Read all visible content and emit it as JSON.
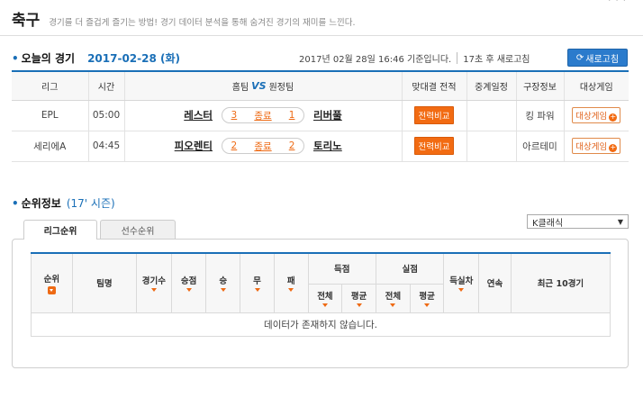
{
  "header": {
    "title": "축구",
    "description": "경기를 더 즐겁게 즐기는 방법! 경기 데이터 분석을 통해 숨겨진 경기의 재미를 느낀다."
  },
  "today": {
    "section_title": "오늘의 경기",
    "date": "2017-02-28 (화)",
    "updated_text": "2017년 02월 28일 16:46 기준입니다.",
    "countdown_text": "17초 후 새로고침",
    "refresh_button": "새로고침",
    "columns": {
      "league": "리그",
      "time": "시간",
      "home": "홈팀",
      "vs": "VS",
      "away": "원정팀",
      "h2h": "맞대결 전적",
      "broadcast": "중계일정",
      "stadium": "구장정보",
      "target": "대상게임"
    },
    "matches": [
      {
        "league": "EPL",
        "time": "05:00",
        "home": "레스터",
        "home_score": "3",
        "status": "종료",
        "away_score": "1",
        "away": "리버풀",
        "h2h_button": "전력비교",
        "broadcast": "",
        "stadium": "킹 파워",
        "target_button": "대상게임"
      },
      {
        "league": "세리에A",
        "time": "04:45",
        "home": "피오렌티",
        "home_score": "2",
        "status": "종료",
        "away_score": "2",
        "away": "토리노",
        "h2h_button": "전력비교",
        "broadcast": "",
        "stadium": "아르테미",
        "target_button": "대상게임"
      }
    ]
  },
  "ranking": {
    "section_title": "순위정보",
    "season": "(17' 시즌)",
    "tabs": [
      "리그순위",
      "선수순위"
    ],
    "league_select": "K클래식",
    "columns": {
      "rank": "순위",
      "team": "팀명",
      "games": "경기수",
      "points": "승점",
      "win": "승",
      "draw": "무",
      "loss": "패",
      "scored": "득점",
      "conceded": "실점",
      "total": "전체",
      "average": "평균",
      "goal_diff": "득실차",
      "streak": "연속",
      "recent": "최근 10경기"
    },
    "empty_message": "데이터가 존재하지 않습니다."
  },
  "colors": {
    "accent_blue": "#1a6fb7",
    "accent_orange": "#f26b12"
  },
  "icons": {
    "refresh": "refresh-icon",
    "sort": "sort-caret-icon",
    "plus": "plus-icon",
    "select": "chevron-down-icon"
  }
}
